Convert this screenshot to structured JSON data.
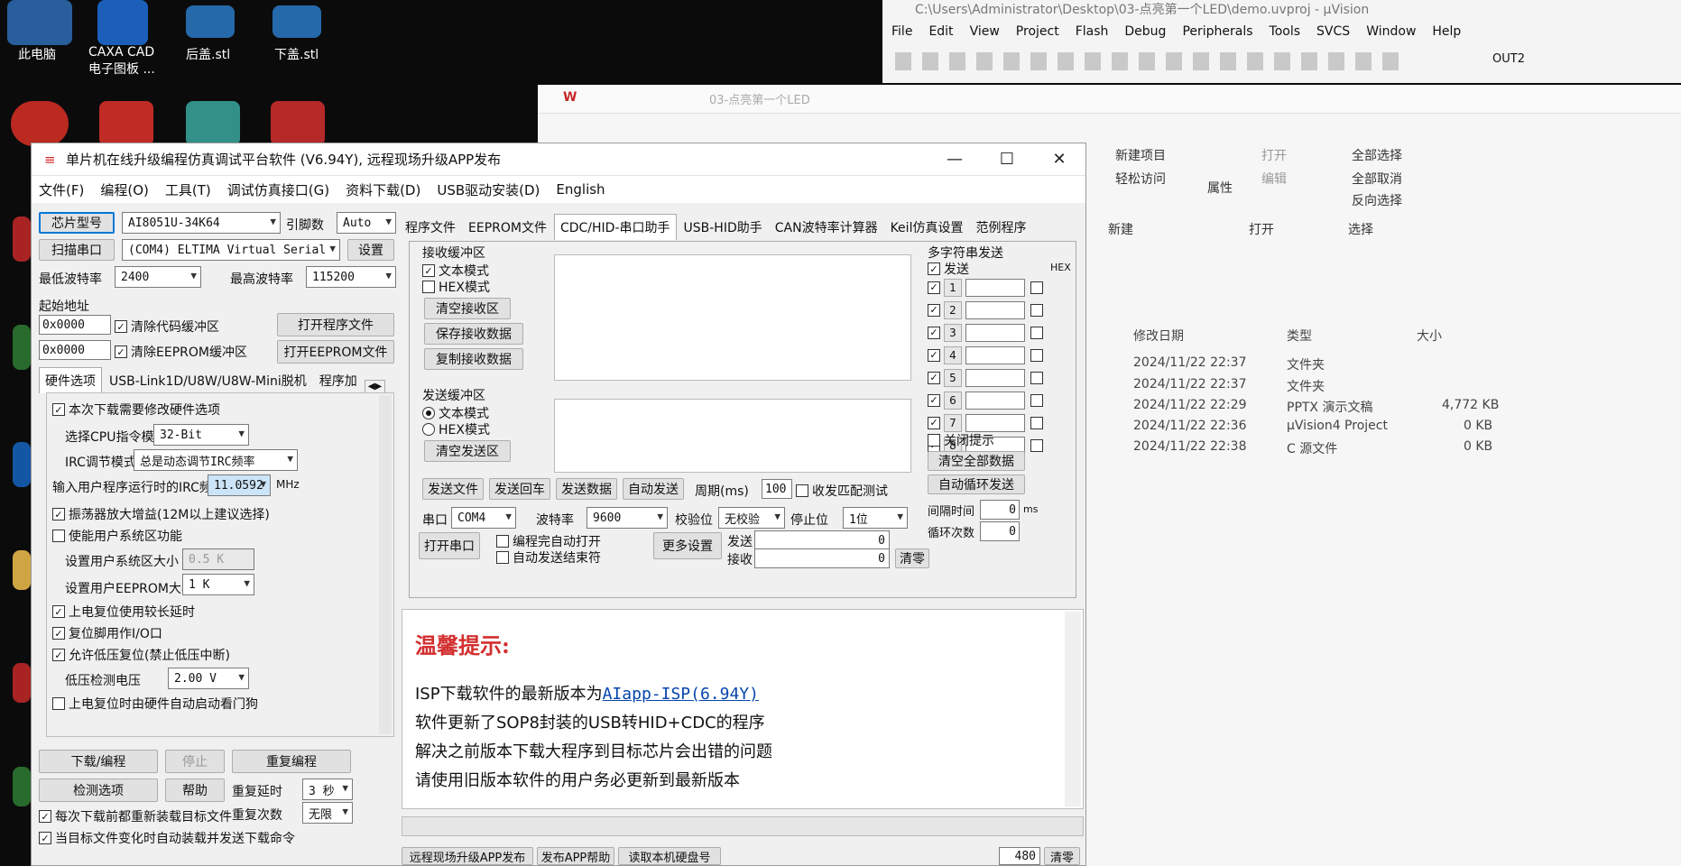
{
  "desktop": {
    "icons": [
      "此电脑",
      "CAXA CAD\n电子图板 ...",
      "后盖.stl",
      "下盖.stl"
    ]
  },
  "keil": {
    "title": "C:\\Users\\Administrator\\Desktop\\03-点亮第一个LED\\demo.uvproj - µVision",
    "menus": [
      "File",
      "Edit",
      "View",
      "Project",
      "Flash",
      "Debug",
      "Peripherals",
      "Tools",
      "SVCS",
      "Window",
      "Help"
    ],
    "target": "OUT2"
  },
  "explorer": {
    "path": "03-点亮第一个LED",
    "ribbon": {
      "new_item": "新建项目",
      "easy_access": "轻松访问",
      "properties": "属性",
      "open": "打开",
      "edit": "编辑",
      "select_all": "全部选择",
      "select_none": "全部取消",
      "invert": "反向选择",
      "group_new": "新建",
      "group_open": "打开",
      "group_select": "选择"
    },
    "columns": [
      "修改日期",
      "类型",
      "大小"
    ],
    "rows": [
      {
        "date": "2024/11/22 22:37",
        "type": "文件夹",
        "size": ""
      },
      {
        "date": "2024/11/22 22:37",
        "type": "文件夹",
        "size": ""
      },
      {
        "date": "2024/11/22 22:29",
        "type": "PPTX 演示文稿",
        "size": "4,772 KB"
      },
      {
        "date": "2024/11/22 22:36",
        "type": "µVision4 Project",
        "size": "0 KB"
      },
      {
        "date": "2024/11/22 22:38",
        "type": "C 源文件",
        "size": "0 KB"
      }
    ]
  },
  "stc": {
    "title": "单片机在线升级编程仿真调试平台软件 (V6.94Y), 远程现场升级APP发布",
    "menu": [
      "文件(F)",
      "编程(O)",
      "工具(T)",
      "调试仿真接口(G)",
      "资料下载(D)",
      "USB驱动安装(D)",
      "English"
    ],
    "chip_label": "芯片型号",
    "chip_value": "AI8051U-34K64",
    "pins_label": "引脚数",
    "pins_value": "Auto",
    "scan_port": "扫描串口",
    "port_value": "(COM4) ELTIMA Virtual Serial",
    "settings": "设置",
    "min_baud_label": "最低波特率",
    "min_baud": "2400",
    "max_baud_label": "最高波特率",
    "max_baud": "115200",
    "start_addr": "起始地址",
    "addr1": "0x0000",
    "clear_code": "清除代码缓冲区",
    "open_prog": "打开程序文件",
    "addr2": "0x0000",
    "clear_eeprom": "清除EEPROM缓冲区",
    "open_eeprom": "打开EEPROM文件",
    "left_tabs": [
      "硬件选项",
      "USB-Link1D/U8W/U8W-Mini脱机",
      "程序加"
    ],
    "hw_options": {
      "modify_hw": "本次下载需要修改硬件选项",
      "cpu_mode_label": "选择CPU指令模式",
      "cpu_mode": "32-Bit",
      "irc_label": "IRC调节模式",
      "irc_mode": "总是动态调节IRC频率",
      "freq_label": "输入用户程序运行时的IRC频率",
      "freq": "11.0592",
      "freq_unit": "MHz",
      "osc_gain": "振荡器放大增益(12M以上建议选择)",
      "user_sys": "使能用户系统区功能",
      "user_sys_size_label": "设置用户系统区大小",
      "user_sys_size": "0.5 K",
      "eeprom_size_label": "设置用户EEPROM大小",
      "eeprom_size": "1 K",
      "long_delay": "上电复位使用较长延时",
      "reset_io": "复位脚用作I/O口",
      "lvr": "允许低压复位(禁止低压中断)",
      "lv_label": "低压检测电压",
      "lv_value": "2.00 V",
      "wdt": "上电复位时由硬件自动启动看门狗"
    },
    "download": "下载/编程",
    "stop": "停止",
    "reprogram": "重复编程",
    "check_options": "检测选项",
    "help": "帮助",
    "repeat_delay_label": "重复延时",
    "repeat_delay": "3 秒",
    "repeat_count_label": "重复次数",
    "repeat_count": "无限",
    "reload_target": "每次下载前都重新装载目标文件",
    "auto_load": "当目标文件变化时自动装载并发送下载命令",
    "right_tabs": [
      "程序文件",
      "EEPROM文件",
      "CDC/HID-串口助手",
      "USB-HID助手",
      "CAN波特率计算器",
      "Keil仿真设置",
      "范例程序"
    ],
    "serial": {
      "recv_buf": "接收缓冲区",
      "text_mode": "文本模式",
      "hex_mode": "HEX模式",
      "clear_recv": "清空接收区",
      "save_recv": "保存接收数据",
      "copy_recv": "复制接收数据",
      "send_buf": "发送缓冲区",
      "clear_send": "清空发送区",
      "send_file": "发送文件",
      "send_cr": "发送回车",
      "send_data": "发送数据",
      "auto_send": "自动发送",
      "period_label": "周期(ms)",
      "period": "100",
      "match_test": "收发匹配测试",
      "port_label": "串口",
      "port": "COM4",
      "baud_label": "波特率",
      "baud": "9600",
      "parity_label": "校验位",
      "parity": "无校验",
      "stop_label": "停止位",
      "stop_bits": "1位",
      "open_port": "打开串口",
      "auto_open": "编程完自动打开",
      "auto_close": "自动发送结束符",
      "more": "更多设置",
      "tx_label": "发送",
      "tx": "0",
      "rx_label": "接收",
      "rx": "0",
      "clear": "清零"
    },
    "multi": {
      "title": "多字符串发送",
      "send": "发送",
      "hex": "HEX",
      "items": [
        "1",
        "2",
        "3",
        "4",
        "5",
        "6",
        "7",
        "8"
      ],
      "close_tip": "关闭提示",
      "clear_all": "清空全部数据",
      "auto_loop": "自动循环发送",
      "interval_label": "间隔时间",
      "interval": "0",
      "interval_unit": "ms",
      "loop_label": "循环次数",
      "loop": "0"
    },
    "notice": {
      "heading": "温馨提示:",
      "line1_pre": "ISP下载软件的最新版本为",
      "line1_link": "AIapp-ISP(6.94Y)",
      "line2": "软件更新了SOP8封装的USB转HID+CDC的程序",
      "line3": "解决之前版本下载大程序到目标芯片会出错的问题",
      "line4": "请使用旧版本软件的用户务必更新到最新版本"
    },
    "bottom": {
      "remote": "远程现场升级APP发布",
      "publish_help": "发布APP帮助",
      "read_disk": "读取本机硬盘号",
      "count": "480",
      "clear": "清零"
    }
  }
}
